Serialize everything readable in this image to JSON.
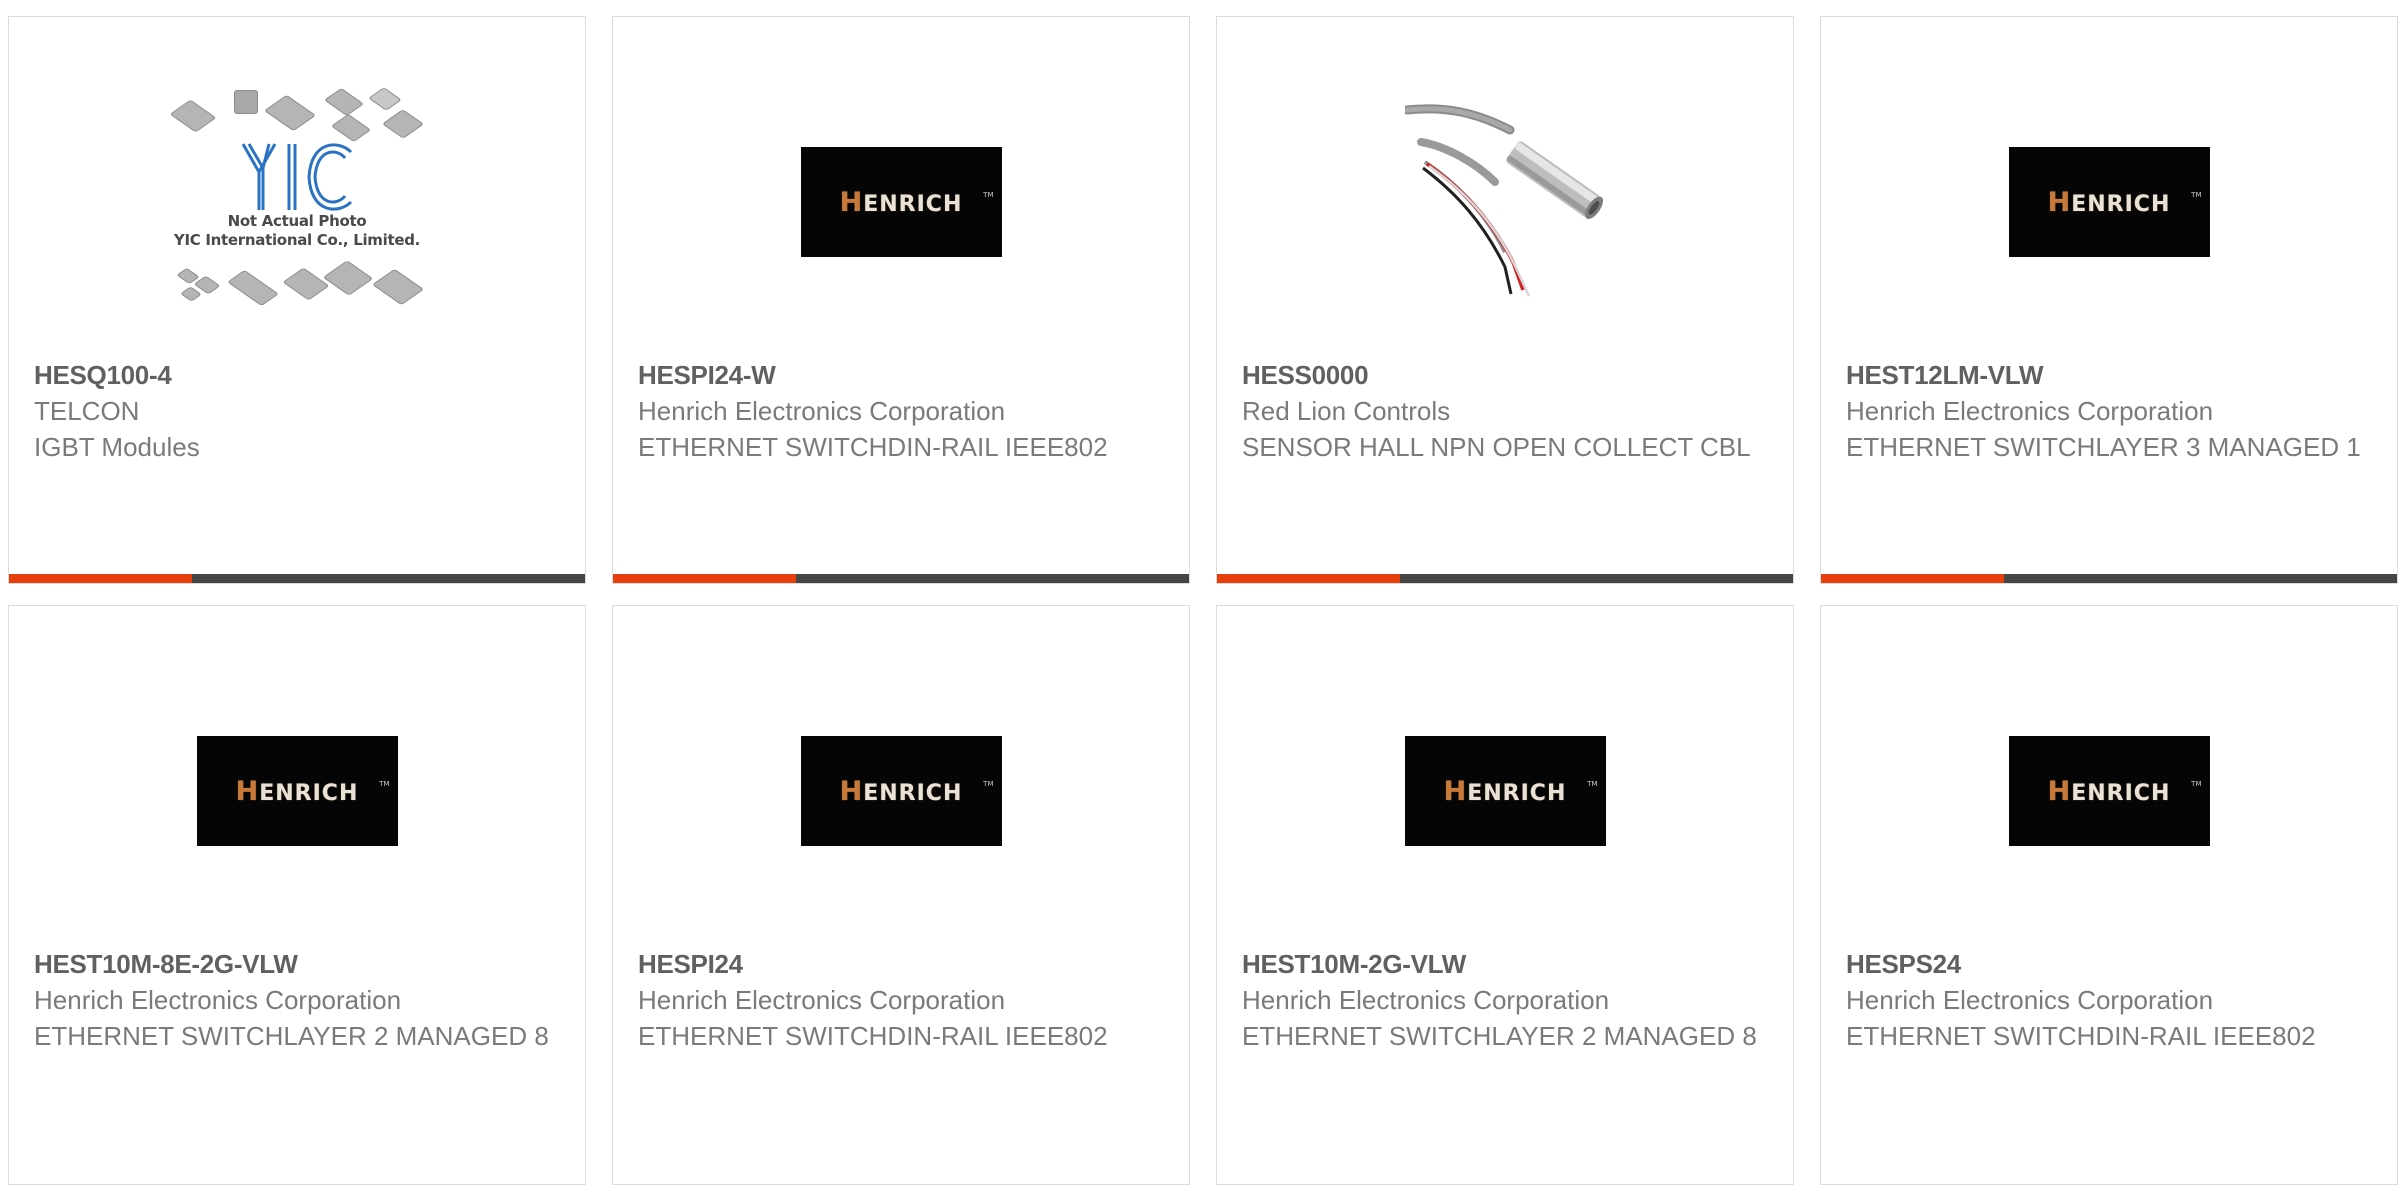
{
  "colors": {
    "accent_orange": "#e8400c",
    "accent_dark": "#454545",
    "card_border": "#dcdcdc",
    "text_primary": "#606060",
    "text_secondary": "#7a7a7a"
  },
  "products": [
    {
      "part_number": "HESQ100-4",
      "manufacturer": "TELCON",
      "description": "IGBT Modules",
      "image": "yic-placeholder",
      "image_caption_line1": "Not Actual Photo",
      "image_caption_line2": "YIC International Co., Limited.",
      "logo_text": "YIC"
    },
    {
      "part_number": "HESPI24-W",
      "manufacturer": "Henrich Electronics Corporation",
      "description": "ETHERNET SWITCHDIN-RAIL IEEE802",
      "image": "henrich-logo",
      "logo_text": "HENRICH"
    },
    {
      "part_number": "HESS0000",
      "manufacturer": "Red Lion Controls",
      "description": "SENSOR HALL NPN OPEN COLLECT CBL",
      "image": "sensor-photo"
    },
    {
      "part_number": "HEST12LM-VLW",
      "manufacturer": "Henrich Electronics Corporation",
      "description": "ETHERNET SWITCHLAYER 3 MANAGED 1",
      "image": "henrich-logo",
      "logo_text": "HENRICH"
    },
    {
      "part_number": "HEST10M-8E-2G-VLW",
      "manufacturer": "Henrich Electronics Corporation",
      "description": "ETHERNET SWITCHLAYER 2 MANAGED 8",
      "image": "henrich-logo",
      "logo_text": "HENRICH"
    },
    {
      "part_number": "HESPI24",
      "manufacturer": "Henrich Electronics Corporation",
      "description": "ETHERNET SWITCHDIN-RAIL IEEE802",
      "image": "henrich-logo",
      "logo_text": "HENRICH"
    },
    {
      "part_number": "HEST10M-2G-VLW",
      "manufacturer": "Henrich Electronics Corporation",
      "description": "ETHERNET SWITCHLAYER 2 MANAGED 8",
      "image": "henrich-logo",
      "logo_text": "HENRICH"
    },
    {
      "part_number": "HESPS24",
      "manufacturer": "Henrich Electronics Corporation",
      "description": "ETHERNET SWITCHDIN-RAIL IEEE802",
      "image": "henrich-logo",
      "logo_text": "HENRICH"
    }
  ]
}
